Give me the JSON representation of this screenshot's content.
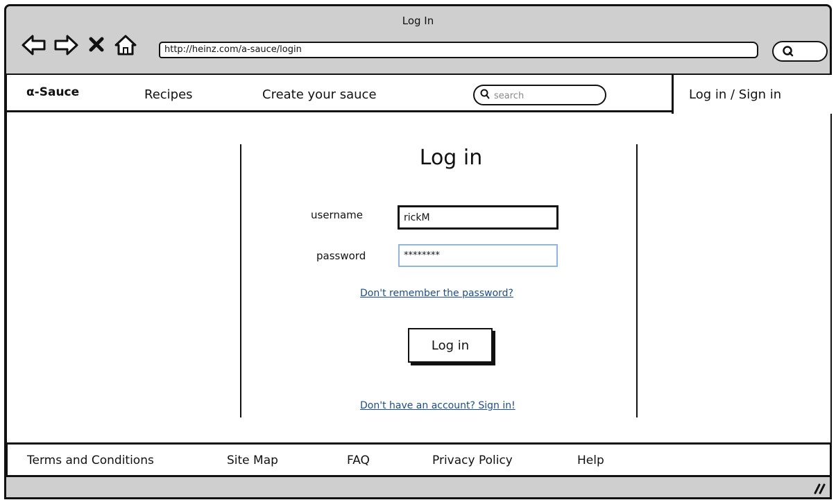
{
  "browser": {
    "title": "Log In",
    "url": "http://heinz.com/a-sauce/login",
    "back_icon": "back-arrow-icon",
    "forward_icon": "forward-arrow-icon",
    "stop_icon": "close-icon",
    "home_icon": "home-icon",
    "search_icon": "search-icon"
  },
  "nav": {
    "logo": "α-Sauce",
    "items": [
      "Recipes",
      "Create your sauce"
    ],
    "search_placeholder": "search",
    "login_tab": "Log in / Sign in"
  },
  "login": {
    "title": "Log in",
    "username_label": "username",
    "username_value": "rickM",
    "password_label": "password",
    "password_value": "********",
    "forgot_link": "Don't remember the password?",
    "submit_label": "Log in",
    "signup_link": "Don't have an account? Sign in!"
  },
  "footer": {
    "links": [
      "Terms and Conditions",
      "Site Map",
      "FAQ",
      "Privacy Policy",
      "Help"
    ]
  },
  "statusbar": {
    "resize_icon": "resize-grip-icon"
  }
}
